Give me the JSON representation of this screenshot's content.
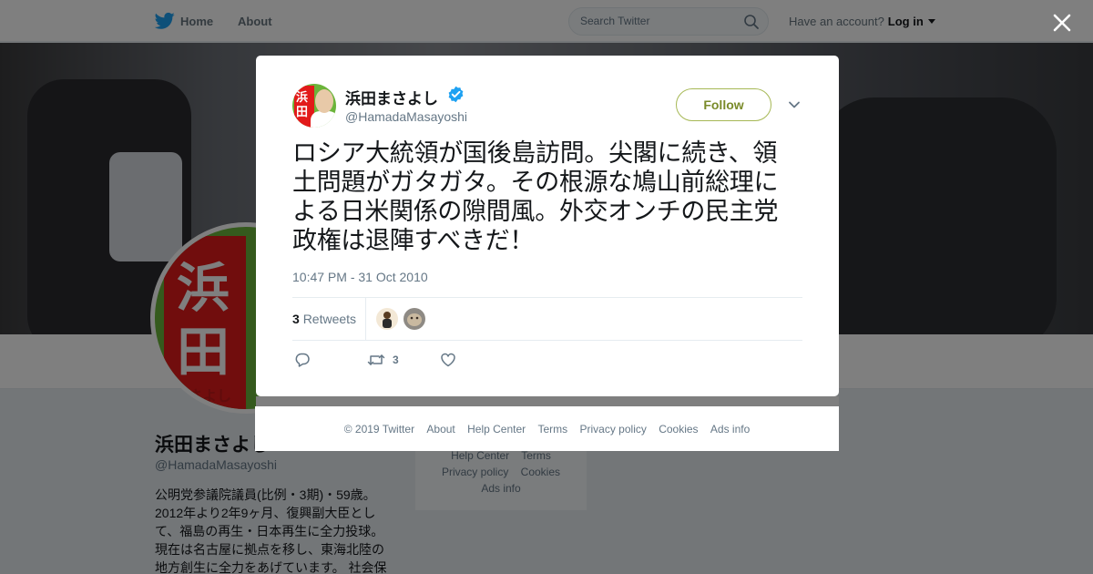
{
  "nav": {
    "home_label": "Home",
    "about_label": "About",
    "search_placeholder": "Search Twitter",
    "account_prompt": "Have an account?",
    "login_label": "Log in"
  },
  "profile": {
    "avatar_kanji_1": "浜",
    "avatar_kanji_2": "田",
    "avatar_sayoshi": "さよし",
    "name": "浜田まさよし",
    "handle": "@HamadaMasayoshi",
    "bio_lines": [
      "公明党参議院議員(比例・3期)・59歳。",
      "2012年より2年9ヶ月、復興副大臣とし",
      "て、福島の再生・日本再生に全力投球。",
      "現在は名古屋に拠点を移し、東海北陸の",
      "地方創生に全力をあげています。 社会保"
    ],
    "side_links": {
      "help_center": "Help Center",
      "terms": "Terms",
      "privacy": "Privacy policy",
      "cookies": "Cookies",
      "ads_info": "Ads info"
    }
  },
  "tweet": {
    "avatar_kanji_1": "浜",
    "avatar_kanji_2": "田",
    "display_name": "浜田まさよし",
    "screen_name": "@HamadaMasayoshi",
    "follow_label": "Follow",
    "text_lines": [
      "ロシア大統領が国後島訪問。尖閣に続き、領",
      "土問題がガタガタ。その根源な鳩山前総理に",
      "よる日米関係の隙間風。外交オンチの民主党",
      "政権は退陣すべきだ！"
    ],
    "timestamp": "10:47 PM - 31 Oct 2010",
    "retweet_count": "3",
    "retweets_label": "Retweets",
    "retweet_action_count": "3"
  },
  "footer": {
    "links": [
      "© 2019 Twitter",
      "About",
      "Help Center",
      "Terms",
      "Privacy policy",
      "Cookies",
      "Ads info"
    ]
  },
  "icons": {
    "brand": "twitter-bird-icon",
    "search": "search-icon",
    "close": "close-icon",
    "verified": "verified-icon",
    "dropdown": "chevron-down-icon",
    "reply": "reply-icon",
    "retweet": "retweet-icon",
    "like": "like-icon"
  },
  "colors": {
    "twitter_blue": "#1da1f2",
    "follow_border": "#a6b855",
    "follow_text": "#7a8b2a",
    "overlay": "rgba(0,0,0,0.5)",
    "muted_text": "#657786"
  }
}
